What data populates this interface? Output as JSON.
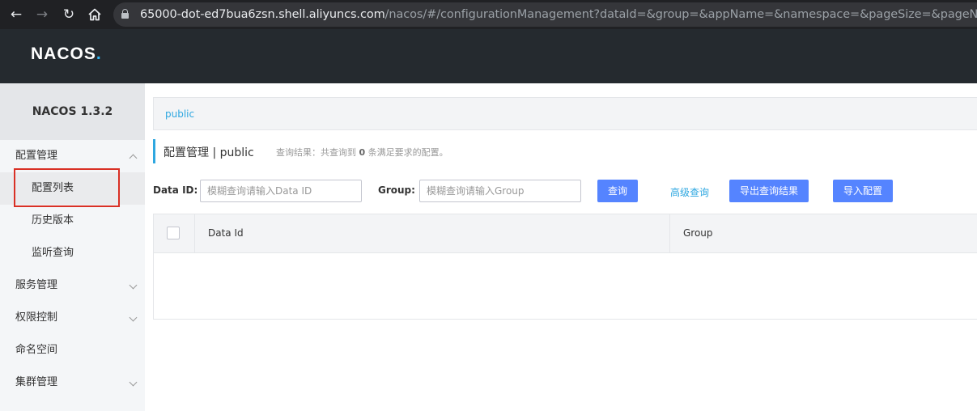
{
  "browser": {
    "url_host": "65000-dot-ed7bua6zsn.shell.aliyuncs.com",
    "url_path": "/nacos/#/configurationManagement?dataId=&group=&appName=&namespace=&pageSize=&pageNo="
  },
  "header": {
    "logo_main": "NACOS",
    "logo_dot": "."
  },
  "sidebar": {
    "version": "NACOS 1.3.2",
    "items": [
      {
        "label": "配置管理",
        "expanded": true
      },
      {
        "label": "配置列表",
        "active": true
      },
      {
        "label": "历史版本"
      },
      {
        "label": "监听查询"
      },
      {
        "label": "服务管理"
      },
      {
        "label": "权限控制"
      },
      {
        "label": "命名空间"
      },
      {
        "label": "集群管理"
      }
    ]
  },
  "breadcrumb": {
    "namespace": "public"
  },
  "page": {
    "title": "配置管理 | public",
    "result_prefix": "查询结果：共查询到 ",
    "result_count": "0",
    "result_suffix": " 条满足要求的配置。"
  },
  "filters": {
    "data_id_label": "Data ID:",
    "data_id_placeholder": "模糊查询请输入Data ID",
    "group_label": "Group:",
    "group_placeholder": "模糊查询请输入Group",
    "search_button": "查询",
    "advanced_link": "高级查询",
    "export_button": "导出查询结果",
    "import_button": "导入配置"
  },
  "table": {
    "columns": [
      "Data Id",
      "Group"
    ],
    "rows": []
  },
  "colors": {
    "primary": "#5584ff",
    "link": "#2ea7e0",
    "highlight": "#d93025"
  }
}
